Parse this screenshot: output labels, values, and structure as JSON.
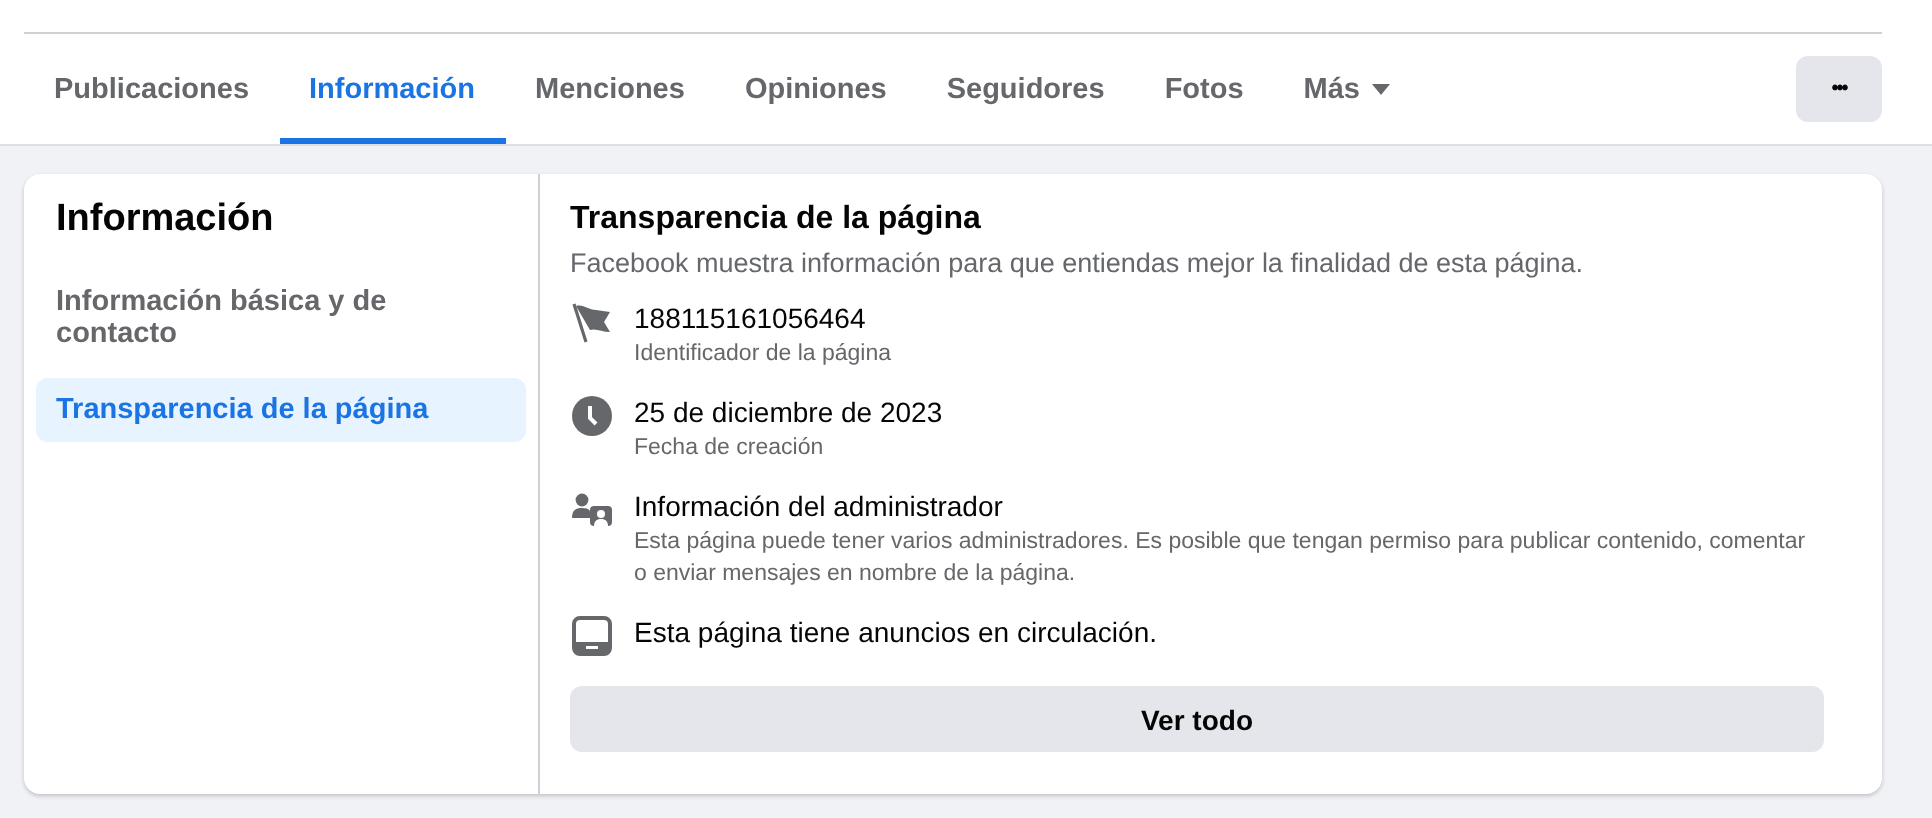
{
  "tabs": [
    {
      "label": "Publicaciones",
      "selected": false
    },
    {
      "label": "Información",
      "selected": true
    },
    {
      "label": "Menciones",
      "selected": false
    },
    {
      "label": "Opiniones",
      "selected": false
    },
    {
      "label": "Seguidores",
      "selected": false
    },
    {
      "label": "Fotos",
      "selected": false
    },
    {
      "label": "Más",
      "selected": false,
      "kind": "dropdown"
    }
  ],
  "more_button": "•••",
  "sidebar": {
    "title": "Información",
    "items": [
      {
        "label": "Información básica y de contacto",
        "selected": false
      },
      {
        "label": "Transparencia de la página",
        "selected": true
      }
    ]
  },
  "section": {
    "title": "Transparencia de la página",
    "description": "Facebook muestra información para que entiendas mejor la finalidad de esta página.",
    "items": [
      {
        "kind": "flag",
        "title": "188115161056464",
        "subtitle": "Identificador de la página"
      },
      {
        "kind": "clock",
        "title": "25 de diciembre de 2023",
        "subtitle": "Fecha de creación"
      },
      {
        "kind": "admin",
        "title": "Información del administrador",
        "subtitle": "Esta página puede tener varios administradores. Es posible que tengan permiso para publicar contenido, comentar o enviar mensajes en nombre de la página."
      },
      {
        "kind": "ads",
        "title": "Esta página tiene anuncios en circulación."
      }
    ],
    "button": "Ver todo"
  }
}
